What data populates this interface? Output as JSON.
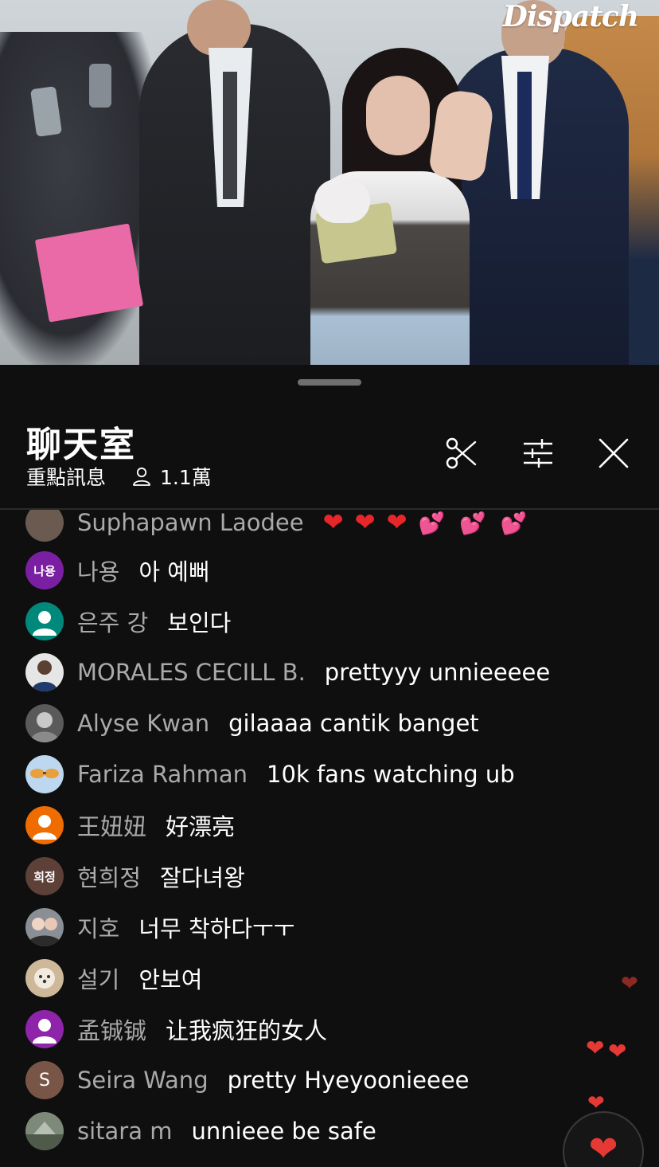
{
  "video": {
    "watermark": "Dispatch"
  },
  "chat": {
    "title": "聊天室",
    "filter_label": "重點訊息",
    "viewer_count": "1.1萬",
    "icons": {
      "clip": "scissors-icon",
      "settings": "tune-icon",
      "close": "close-icon",
      "viewers": "person-icon",
      "like": "heart-icon"
    },
    "messages": [
      {
        "author": "Suphapawn Laodee",
        "text": "",
        "avatar_text": "",
        "avatar_color": "#6b5a50",
        "emoji": "hearts"
      },
      {
        "author": "나용",
        "text": "아 예뻐",
        "avatar_text": "나용",
        "avatar_color": "#7b1fa2"
      },
      {
        "author": "은주 강",
        "text": "보인다",
        "avatar_text": "",
        "avatar_color": "#00897b"
      },
      {
        "author": "MORALES CECILL B.",
        "text": "prettyyy unnieeeee",
        "avatar_text": "",
        "avatar_color": "#e6e6e6"
      },
      {
        "author": "Alyse Kwan",
        "text": "gilaaaa cantik banget",
        "avatar_text": "",
        "avatar_color": "#5a5a5a"
      },
      {
        "author": "Fariza Rahman",
        "text": "10k fans watching ub",
        "avatar_text": "",
        "avatar_color": "#bcd7ef"
      },
      {
        "author": "王妞妞",
        "text": "好漂亮",
        "avatar_text": "",
        "avatar_color": "#ef6c00"
      },
      {
        "author": "현희정",
        "text": "잘다녀왕",
        "avatar_text": "희정",
        "avatar_color": "#5d4037"
      },
      {
        "author": "지호",
        "text": "너무 착하다ㅜㅜ",
        "avatar_text": "",
        "avatar_color": "#8a8f96"
      },
      {
        "author": "설기",
        "text": "안보여",
        "avatar_text": "",
        "avatar_color": "#cdb89a"
      },
      {
        "author": "孟铖铖",
        "text": "让我疯狂的女人",
        "avatar_text": "",
        "avatar_color": "#8e24aa"
      },
      {
        "author": "Seira Wang",
        "text": "pretty Hyeyoonieeee",
        "avatar_text": "S",
        "avatar_color": "#795548"
      },
      {
        "author": "sitara m",
        "text": "unnieee be safe",
        "avatar_text": "",
        "avatar_color": "#7d8a7a"
      }
    ]
  },
  "colors": {
    "background": "#0f0f0f",
    "author": "#aaaaaa",
    "heart": "#e53935"
  }
}
